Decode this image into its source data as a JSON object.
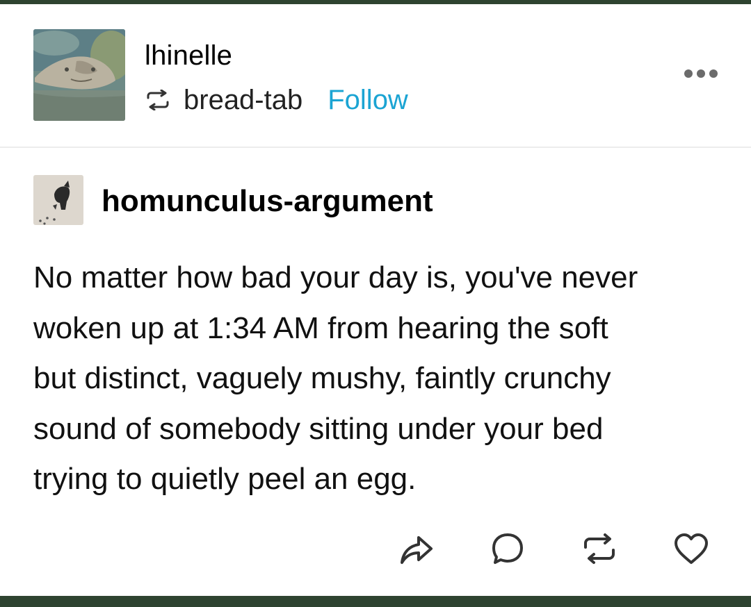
{
  "post": {
    "reblogger": {
      "username": "lhinelle",
      "reblogged_from": "bread-tab",
      "follow_label": "Follow"
    },
    "original": {
      "username": "homunculus-argument",
      "body_lines": [
        "No matter how bad your day is, you've never",
        "woken up at 1:34 AM from hearing the soft",
        "but distinct, vaguely mushy, faintly crunchy",
        "sound of somebody sitting under your bed",
        "trying to quietly peel an egg."
      ]
    },
    "actions": [
      "share-icon",
      "comment-icon",
      "reblog-icon",
      "like-icon"
    ]
  },
  "colors": {
    "frame": "#2e4330",
    "follow": "#1ba4d3",
    "divider": "#ececec"
  }
}
